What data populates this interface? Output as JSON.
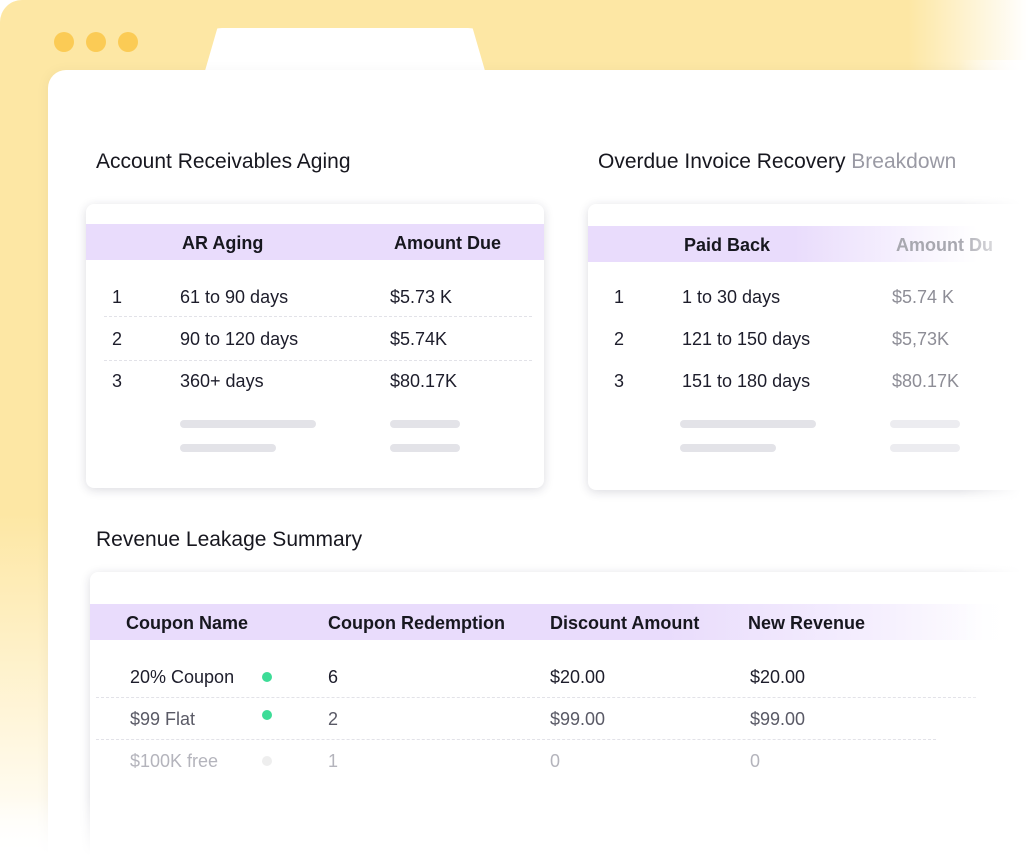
{
  "sections": {
    "ar_aging": {
      "title": "Account Receivables Aging",
      "columns": [
        "AR Aging",
        "Amount Due"
      ],
      "rows": [
        {
          "index": "1",
          "range": "61 to 90 days",
          "amount": "$5.73 K"
        },
        {
          "index": "2",
          "range": "90 to 120 days",
          "amount": "$5.74K"
        },
        {
          "index": "3",
          "range": "360+ days",
          "amount": "$80.17K"
        }
      ]
    },
    "recovery": {
      "title_main": "Overdue Invoice Recovery",
      "title_faded": "Breakdown",
      "columns": [
        "Paid Back",
        "Amount Du"
      ],
      "rows": [
        {
          "index": "1",
          "range": "1 to 30 days",
          "amount": "$5.74 K"
        },
        {
          "index": "2",
          "range": "121 to 150 days",
          "amount": "$5,73K"
        },
        {
          "index": "3",
          "range": "151 to 180 days",
          "amount": "$80.17K"
        }
      ]
    },
    "leakage": {
      "title": "Revenue Leakage Summary",
      "columns": [
        "Coupon Name",
        "Coupon Redemption",
        "Discount Amount",
        "New Revenue"
      ],
      "rows": [
        {
          "name": "20% Coupon",
          "status_color": "#3ddc97",
          "redemption": "6",
          "discount": "$20.00",
          "revenue": "$20.00"
        },
        {
          "name": "$99 Flat",
          "status_color": "#3ddc97",
          "redemption": "2",
          "discount": "$99.00",
          "revenue": "$99.00"
        },
        {
          "name": "$100K free",
          "status_color": "#eeeeee",
          "redemption": "1",
          "discount": "0",
          "revenue": "0"
        }
      ]
    }
  },
  "colors": {
    "accent_header": "#e9dcfc",
    "folder": "#fde7a4",
    "window_dot": "#fbcb55",
    "active_status": "#3ddc97"
  }
}
